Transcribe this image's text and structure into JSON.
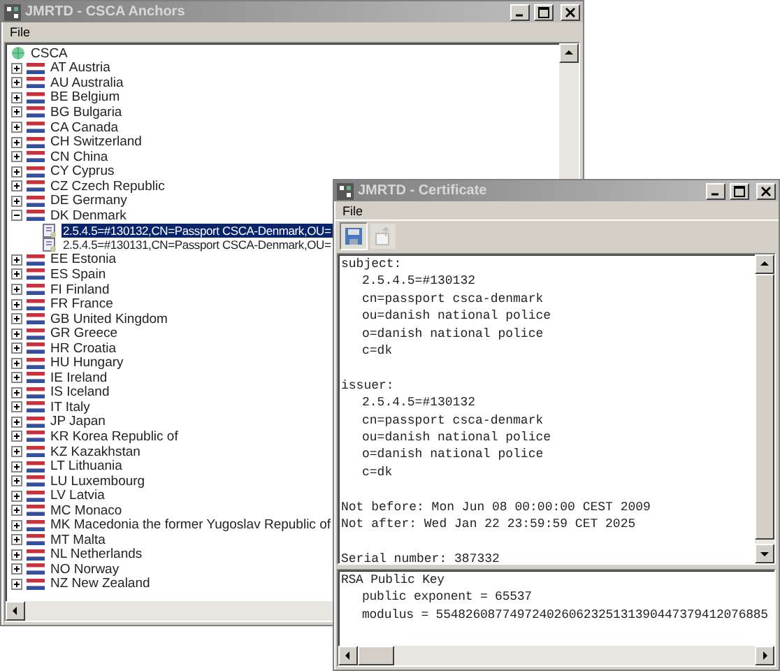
{
  "anchors_window": {
    "title": "JMRTD - CSCA Anchors",
    "menu": [
      "File"
    ],
    "tree": {
      "root": "CSCA",
      "items": [
        {
          "label": "AT Austria",
          "expanded": false,
          "selected": false
        },
        {
          "label": "AU Australia",
          "expanded": false,
          "selected": false
        },
        {
          "label": "BE Belgium",
          "expanded": false,
          "selected": false
        },
        {
          "label": "BG Bulgaria",
          "expanded": false,
          "selected": false
        },
        {
          "label": "CA Canada",
          "expanded": false,
          "selected": false
        },
        {
          "label": "CH Switzerland",
          "expanded": false,
          "selected": false
        },
        {
          "label": "CN China",
          "expanded": false,
          "selected": false
        },
        {
          "label": "CY Cyprus",
          "expanded": false,
          "selected": false
        },
        {
          "label": "CZ Czech Republic",
          "expanded": false,
          "selected": false
        },
        {
          "label": "DE Germany",
          "expanded": false,
          "selected": false
        },
        {
          "label": "DK Denmark",
          "expanded": true,
          "selected": false,
          "children": [
            {
              "label": "2.5.4.5=#130132,CN=Passport CSCA-Denmark,OU=",
              "selected": true
            },
            {
              "label": "2.5.4.5=#130131,CN=Passport CSCA-Denmark,OU=",
              "selected": false
            }
          ]
        },
        {
          "label": "EE Estonia",
          "expanded": false,
          "selected": false
        },
        {
          "label": "ES Spain",
          "expanded": false,
          "selected": false
        },
        {
          "label": "FI Finland",
          "expanded": false,
          "selected": false
        },
        {
          "label": "FR France",
          "expanded": false,
          "selected": false
        },
        {
          "label": "GB United Kingdom",
          "expanded": false,
          "selected": false
        },
        {
          "label": "GR Greece",
          "expanded": false,
          "selected": false
        },
        {
          "label": "HR Croatia",
          "expanded": false,
          "selected": false
        },
        {
          "label": "HU Hungary",
          "expanded": false,
          "selected": false
        },
        {
          "label": "IE Ireland",
          "expanded": false,
          "selected": false
        },
        {
          "label": "IS Iceland",
          "expanded": false,
          "selected": false
        },
        {
          "label": "IT Italy",
          "expanded": false,
          "selected": false
        },
        {
          "label": "JP Japan",
          "expanded": false,
          "selected": false
        },
        {
          "label": "KR Korea Republic of",
          "expanded": false,
          "selected": false
        },
        {
          "label": "KZ Kazakhstan",
          "expanded": false,
          "selected": false
        },
        {
          "label": "LT Lithuania",
          "expanded": false,
          "selected": false
        },
        {
          "label": "LU Luxembourg",
          "expanded": false,
          "selected": false
        },
        {
          "label": "LV Latvia",
          "expanded": false,
          "selected": false
        },
        {
          "label": "MC Monaco",
          "expanded": false,
          "selected": false
        },
        {
          "label": "MK Macedonia the former Yugoslav Republic of",
          "expanded": false,
          "selected": false
        },
        {
          "label": "MT Malta",
          "expanded": false,
          "selected": false
        },
        {
          "label": "NL Netherlands",
          "expanded": false,
          "selected": false
        },
        {
          "label": "NO Norway",
          "expanded": false,
          "selected": false
        },
        {
          "label": "NZ New Zealand",
          "expanded": false,
          "selected": false
        }
      ]
    }
  },
  "certificate_window": {
    "title": "JMRTD - Certificate",
    "menu": [
      "File"
    ],
    "details": [
      {
        "heading": "subject:",
        "lines": [
          "2.5.4.5=#130132",
          "cn=passport csca-denmark",
          "ou=danish national police",
          "o=danish national police",
          "c=dk"
        ]
      },
      {
        "heading": "issuer:",
        "lines": [
          "2.5.4.5=#130132",
          "cn=passport csca-denmark",
          "ou=danish national police",
          "o=danish national police",
          "c=dk"
        ]
      },
      {
        "lines": [
          "Not before: Mon Jun 08 00:00:00 CEST 2009",
          "Not after: Wed Jan 22 23:59:59 CET 2025"
        ]
      },
      {
        "lines": [
          "Serial number: 387332"
        ]
      }
    ],
    "public_key": {
      "heading": "RSA Public Key",
      "lines": [
        "public exponent = 65537",
        "modulus = 554826087749724026062325131390447379412076885"
      ]
    }
  }
}
